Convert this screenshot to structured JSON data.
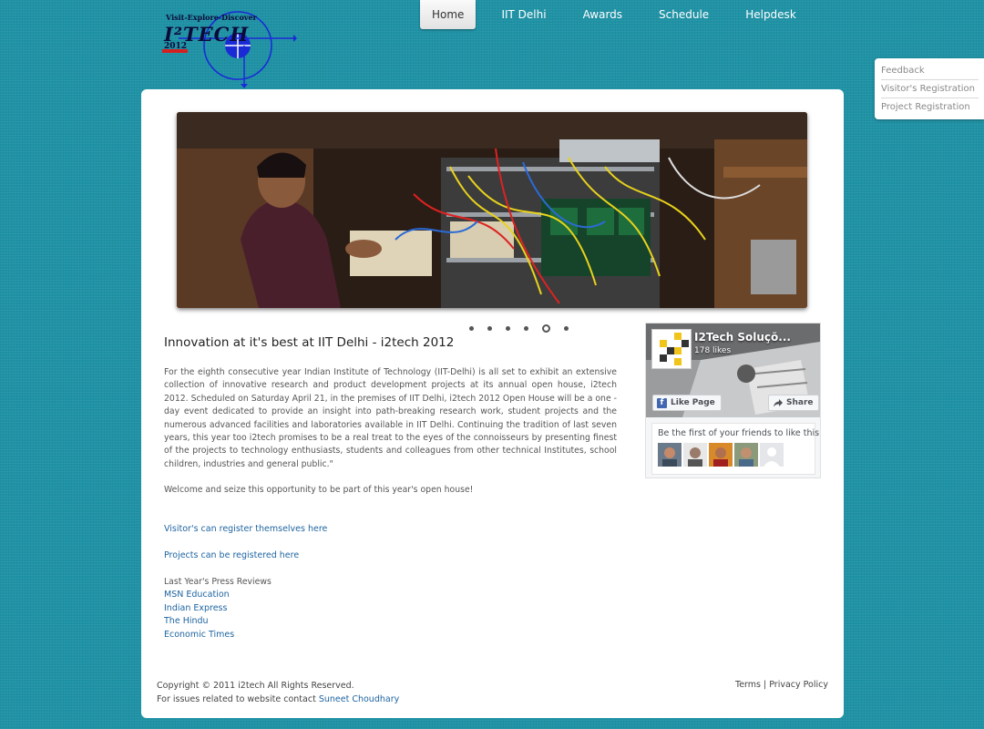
{
  "logo": {
    "tagline": "Visit-Explore-Discover",
    "brand": "I²TECH",
    "year": "2012"
  },
  "nav": {
    "items": [
      {
        "label": "Home",
        "active": true
      },
      {
        "label": "IIT Delhi"
      },
      {
        "label": "Awards"
      },
      {
        "label": "Schedule"
      },
      {
        "label": "Helpdesk"
      }
    ]
  },
  "side_menu": {
    "items": [
      {
        "label": "Feedback"
      },
      {
        "label": "Visitor's Registration"
      },
      {
        "label": "Project Registration"
      }
    ]
  },
  "slider": {
    "dot_count": 6,
    "active_index": 4
  },
  "main": {
    "headline": "Innovation at it's best at IIT Delhi - i2tech 2012",
    "body": "For the eighth consecutive year Indian Institute of Technology (IIT-Delhi) is all set to exhibit an extensive collection of innovative research and product development projects at its annual open house, i2tech 2012. Scheduled on Saturday April 21, in the premises of IIT Delhi, i2tech 2012 Open House will be a one - day event dedicated to provide an insight into path-breaking research work, student projects and the numerous advanced facilities and laboratories available in IIT Delhi. Continuing the tradition of last seven years, this year too i2tech promises to be a real treat to the eyes of the connoisseurs by presenting finest of the projects to technology enthusiasts, students and colleagues from other technical Institutes, school children, industries and general public.\"",
    "welcome": "Welcome and seize this opportunity to be part of this year's open house!",
    "visitor_link": "Visitor's can register themselves here",
    "project_link": "Projects can be registered here",
    "press_heading": "Last Year's Press Reviews",
    "press_links": [
      "MSN Education",
      "Indian Express",
      "The Hindu",
      "Economic Times"
    ]
  },
  "fb_widget": {
    "page_name": "I2Tech Soluçõ...",
    "likes": "178 likes",
    "like_button": "Like Page",
    "share_button": "Share",
    "friends_text": "Be the first of your friends to like this",
    "brand_color": "#4267b2"
  },
  "footer": {
    "copyright": "Copyright © 2011 i2tech All Rights Reserved.",
    "contact_prefix": "For issues related to website contact",
    "contact_name": "Suneet Choudhary",
    "terms": "Terms",
    "separator": "|",
    "privacy": "Privacy Policy"
  },
  "colors": {
    "background": "#1f93a6",
    "link": "#1e64a0",
    "card": "#ffffff"
  }
}
